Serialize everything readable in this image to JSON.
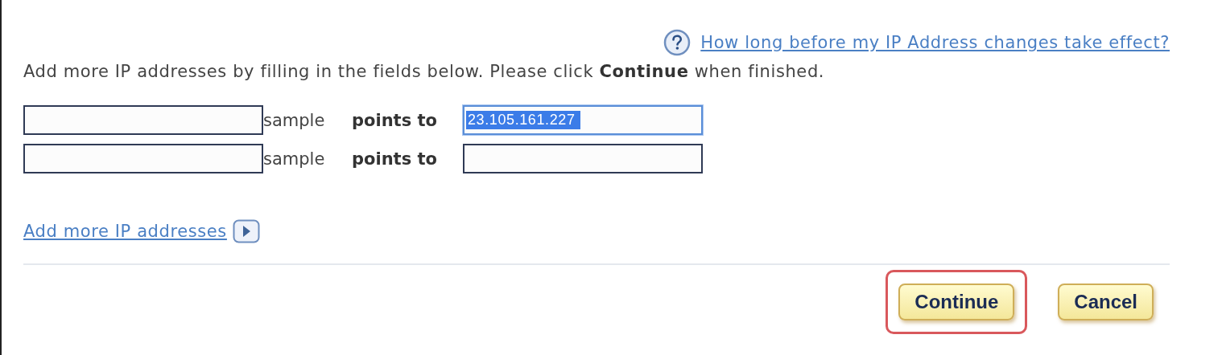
{
  "help_link": {
    "label": "How long before my IP Address changes take effect?"
  },
  "instructions": "Add more IP addresses by filling in the fields below. Please click **Continue** when finished.",
  "rows": [
    {
      "name_value": "",
      "suffix": "sample",
      "points_to": "points to",
      "target_value": "23.105.161.227",
      "target_text_selected": true,
      "target_focused": true
    },
    {
      "name_value": "",
      "suffix": "sample",
      "points_to": "points to",
      "target_value": "",
      "target_focused": false
    }
  ],
  "add_more_link": {
    "label": "Add more IP addresses"
  },
  "buttons": [
    {
      "label": "Continue",
      "highlighted": true
    },
    {
      "label": "Cancel",
      "highlighted": false
    }
  ]
}
